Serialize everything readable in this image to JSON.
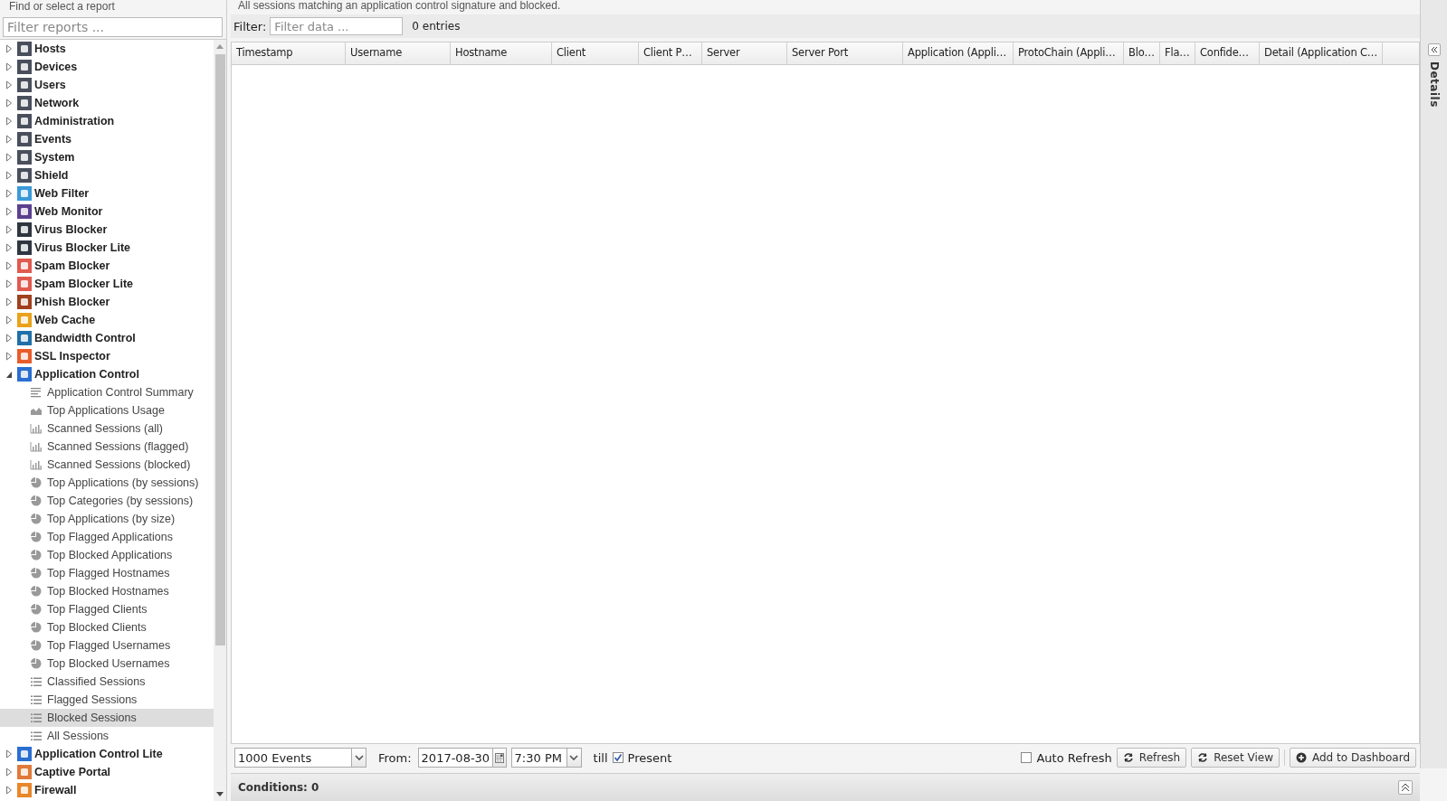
{
  "sidebar": {
    "header": "Find or select a report",
    "filter_placeholder": "Filter reports ...",
    "tree": [
      {
        "label": "Hosts",
        "expanded": false,
        "selected": false,
        "color": "#4a4f5c"
      },
      {
        "label": "Devices",
        "expanded": false,
        "selected": false,
        "color": "#4a4f5c"
      },
      {
        "label": "Users",
        "expanded": false,
        "selected": false,
        "color": "#4a4f5c"
      },
      {
        "label": "Network",
        "expanded": false,
        "selected": false,
        "color": "#4a4f5c"
      },
      {
        "label": "Administration",
        "expanded": false,
        "selected": false,
        "color": "#4a4f5c"
      },
      {
        "label": "Events",
        "expanded": false,
        "selected": false,
        "color": "#4a4f5c"
      },
      {
        "label": "System",
        "expanded": false,
        "selected": false,
        "color": "#4a4f5c"
      },
      {
        "label": "Shield",
        "expanded": false,
        "selected": false,
        "color": "#4a4f5c"
      },
      {
        "label": "Web Filter",
        "expanded": false,
        "selected": false,
        "color": "#3a9ad9"
      },
      {
        "label": "Web Monitor",
        "expanded": false,
        "selected": false,
        "color": "#5b3f8f"
      },
      {
        "label": "Virus Blocker",
        "expanded": false,
        "selected": false,
        "color": "#2f3640"
      },
      {
        "label": "Virus Blocker Lite",
        "expanded": false,
        "selected": false,
        "color": "#2f3641"
      },
      {
        "label": "Spam Blocker",
        "expanded": false,
        "selected": false,
        "color": "#e05a4f"
      },
      {
        "label": "Spam Blocker Lite",
        "expanded": false,
        "selected": false,
        "color": "#e05a50"
      },
      {
        "label": "Phish Blocker",
        "expanded": false,
        "selected": false,
        "color": "#a0401c"
      },
      {
        "label": "Web Cache",
        "expanded": false,
        "selected": false,
        "color": "#e8a21c"
      },
      {
        "label": "Bandwidth Control",
        "expanded": false,
        "selected": false,
        "color": "#1f6fa8"
      },
      {
        "label": "SSL Inspector",
        "expanded": false,
        "selected": false,
        "color": "#e85d2a"
      },
      {
        "label": "Application Control",
        "expanded": true,
        "selected": false,
        "color": "#2a6fd0",
        "children": [
          {
            "label": "Application Control Summary",
            "kind": "summary",
            "selected": false
          },
          {
            "label": "Top Applications Usage",
            "kind": "area",
            "selected": false
          },
          {
            "label": "Scanned Sessions (all)",
            "kind": "bar",
            "selected": false
          },
          {
            "label": "Scanned Sessions (flagged)",
            "kind": "bar",
            "selected": false
          },
          {
            "label": "Scanned Sessions (blocked)",
            "kind": "bar",
            "selected": false
          },
          {
            "label": "Top Applications (by sessions)",
            "kind": "pie",
            "selected": false
          },
          {
            "label": "Top Categories (by sessions)",
            "kind": "pie",
            "selected": false
          },
          {
            "label": "Top Applications (by size)",
            "kind": "pie",
            "selected": false
          },
          {
            "label": "Top Flagged Applications",
            "kind": "pie",
            "selected": false
          },
          {
            "label": "Top Blocked Applications",
            "kind": "pie",
            "selected": false
          },
          {
            "label": "Top Flagged Hostnames",
            "kind": "pie",
            "selected": false
          },
          {
            "label": "Top Blocked Hostnames",
            "kind": "pie",
            "selected": false
          },
          {
            "label": "Top Flagged Clients",
            "kind": "pie",
            "selected": false
          },
          {
            "label": "Top Blocked Clients",
            "kind": "pie",
            "selected": false
          },
          {
            "label": "Top Flagged Usernames",
            "kind": "pie",
            "selected": false
          },
          {
            "label": "Top Blocked Usernames",
            "kind": "pie",
            "selected": false
          },
          {
            "label": "Classified Sessions",
            "kind": "list",
            "selected": false
          },
          {
            "label": "Flagged Sessions",
            "kind": "list",
            "selected": false
          },
          {
            "label": "Blocked Sessions",
            "kind": "list",
            "selected": true
          },
          {
            "label": "All Sessions",
            "kind": "list",
            "selected": false
          }
        ]
      },
      {
        "label": "Application Control Lite",
        "expanded": false,
        "selected": false,
        "color": "#2a6fd1"
      },
      {
        "label": "Captive Portal",
        "expanded": false,
        "selected": false,
        "color": "#e07a3a"
      },
      {
        "label": "Firewall",
        "expanded": false,
        "selected": false,
        "color": "#e8872a"
      }
    ]
  },
  "report": {
    "description": "All sessions matching an application control signature and blocked.",
    "filter_label": "Filter:",
    "filter_placeholder": "Filter data ...",
    "count": "0 entries",
    "columns": [
      "Timestamp",
      "Username",
      "Hostname",
      "Client",
      "Client P…",
      "Server",
      "Server Port",
      "Application (Appli…",
      "ProtoChain (Appli…",
      "Blo…",
      "Fla…",
      "Confide…",
      "Detail (Application C…"
    ],
    "toolbar": {
      "limit": "1000 Events",
      "from_label": "From:",
      "date": "2017-08-30",
      "time": "7:30 PM",
      "till": "till",
      "present": {
        "label": "Present",
        "checked": true
      },
      "auto_refresh": {
        "label": "Auto Refresh",
        "checked": false
      },
      "buttons": [
        {
          "label": "Refresh",
          "kind": "refresh"
        },
        {
          "label": "Reset View",
          "kind": "refresh"
        },
        {
          "label": "Add to Dashboard",
          "kind": "add"
        }
      ]
    },
    "conditions": "Conditions: 0"
  },
  "details_tab": "Details"
}
